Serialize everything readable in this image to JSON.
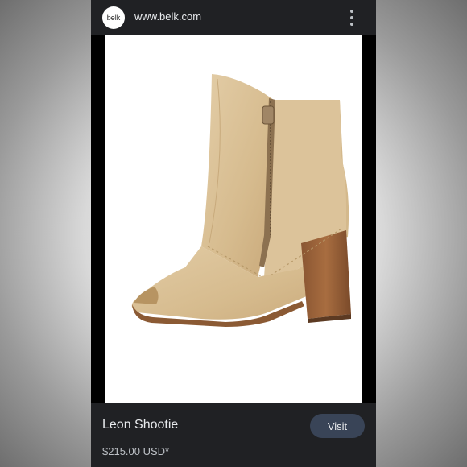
{
  "header": {
    "logo_text": "belk",
    "url": "www.belk.com",
    "menu_icon": "more-vert-icon"
  },
  "product": {
    "title": "Leon Shootie",
    "price": "$215.00 USD*",
    "visit_label": "Visit",
    "image": "tan-leather-peep-toe-bootie-image"
  },
  "colors": {
    "card_bg": "#202124",
    "visit_button_bg": "#394457",
    "text_primary": "#e8eaed"
  }
}
